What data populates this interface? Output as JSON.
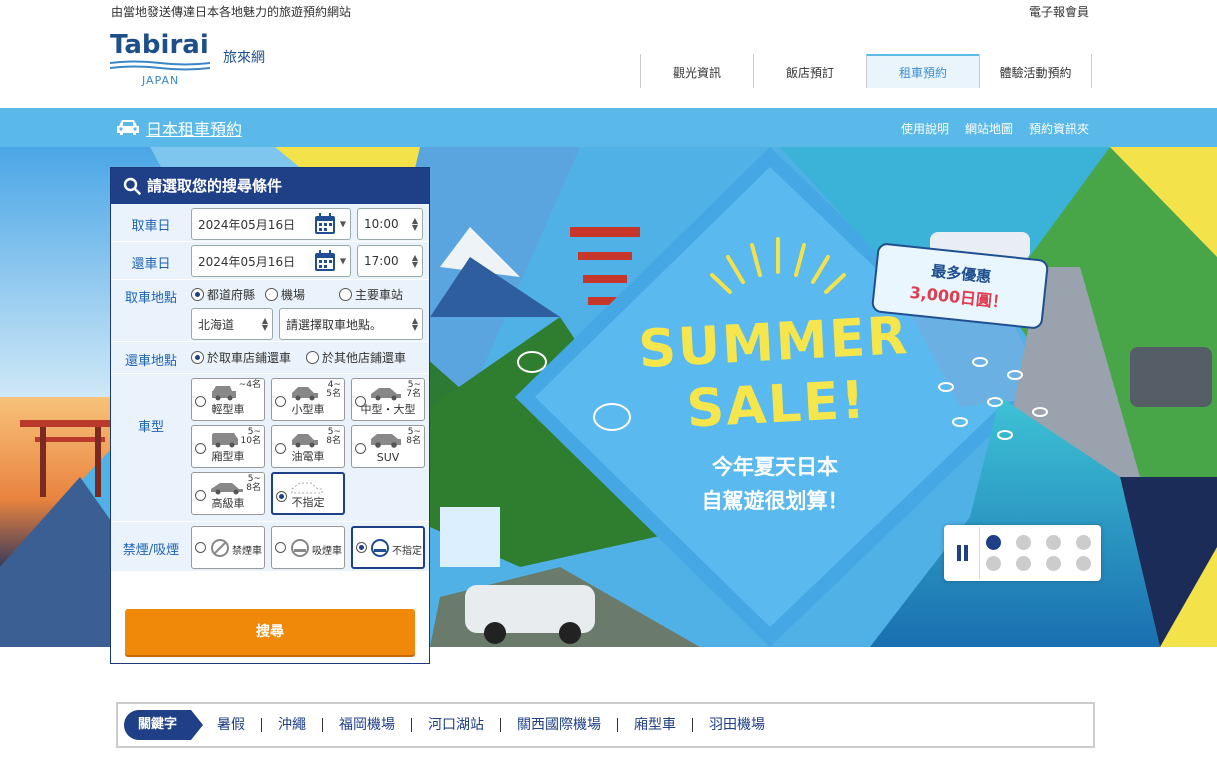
{
  "header": {
    "tagline": "由當地發送傳達日本各地魅力的旅遊預約網站",
    "member_link": "電子報會員",
    "logo_text": "Tabirai",
    "logo_sub": "JAPAN",
    "site_name": "旅來網",
    "nav": [
      {
        "label": "觀光資訊",
        "active": false
      },
      {
        "label": "飯店預訂",
        "active": false
      },
      {
        "label": "租車預約",
        "active": true
      },
      {
        "label": "體驗活動預約",
        "active": false
      }
    ]
  },
  "subbar": {
    "title": "日本租車預約",
    "links": [
      "使用說明",
      "網站地圖",
      "預約資訊夾"
    ]
  },
  "search": {
    "heading": "請選取您的搜尋條件",
    "pickup_date_label": "取車日",
    "pickup_date": "2024年05月16日",
    "pickup_time": "10:00",
    "return_date_label": "還車日",
    "return_date": "2024年05月16日",
    "return_time": "17:00",
    "pickup_place_label": "取車地點",
    "pickup_place_options": [
      "都道府縣",
      "機場",
      "主要車站"
    ],
    "pickup_place_selected": 0,
    "prefecture": "北海道",
    "location_placeholder": "請選擇取車地點。",
    "return_place_label": "還車地點",
    "return_place_options": [
      "於取車店鋪還車",
      "於其他店鋪還車"
    ],
    "return_place_selected": 0,
    "car_type_label": "車型",
    "car_types": [
      {
        "name": "輕型車",
        "cap1": "~4名",
        "cap2": ""
      },
      {
        "name": "小型車",
        "cap1": "4~",
        "cap2": "5名"
      },
      {
        "name": "中型・大型",
        "cap1": "5~",
        "cap2": "7名"
      },
      {
        "name": "廂型車",
        "cap1": "5~",
        "cap2": "10名"
      },
      {
        "name": "油電車",
        "cap1": "5~",
        "cap2": "8名"
      },
      {
        "name": "SUV",
        "cap1": "5~",
        "cap2": "8名"
      },
      {
        "name": "高級車",
        "cap1": "5~",
        "cap2": "8名"
      },
      {
        "name": "不指定",
        "cap1": "",
        "cap2": ""
      }
    ],
    "car_type_selected": 7,
    "smoking_label": "禁煙/吸煙",
    "smoking_options": [
      "禁煙車",
      "吸煙車",
      "不指定"
    ],
    "smoking_selected": 2,
    "search_button": "搜尋"
  },
  "banner": {
    "headline_1": "SUMMER",
    "headline_2": "SALE!",
    "sub_1": "今年夏天日本",
    "sub_2": "自駕遊很划算！",
    "badge_1": "最多優惠",
    "badge_2": "3,000日圓！",
    "slide_count": 8,
    "active_slide": 0
  },
  "keywords": {
    "label": "關鍵字",
    "items": [
      "暑假",
      "沖繩",
      "福岡機場",
      "河口湖站",
      "關西國際機場",
      "廂型車",
      "羽田機場"
    ]
  },
  "colors": {
    "navy": "#1f3f86",
    "sky": "#5ab9e9",
    "orange": "#f0890a",
    "banner_yellow": "#f4e24a"
  }
}
